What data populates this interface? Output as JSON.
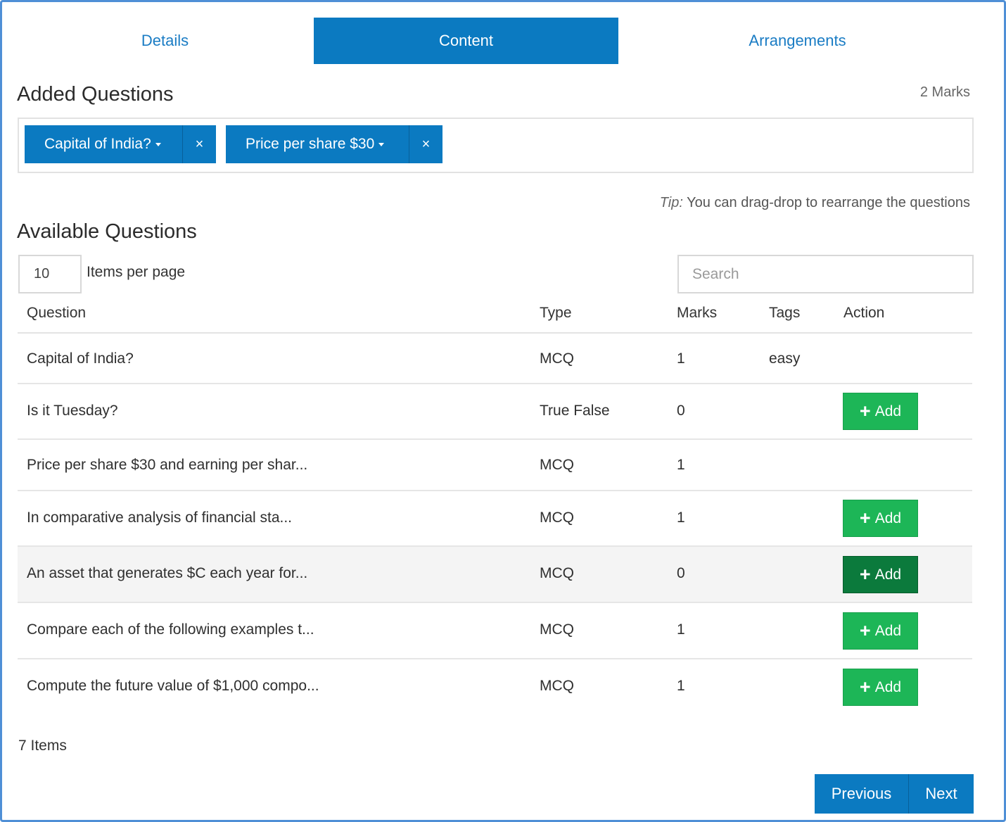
{
  "tabs": [
    {
      "label": "Details",
      "active": false
    },
    {
      "label": "Content",
      "active": true
    },
    {
      "label": "Arrangements",
      "active": false
    }
  ],
  "added": {
    "title": "Added Questions",
    "marks": "2 Marks",
    "chips": [
      {
        "label": "Capital of India?",
        "remove": "×"
      },
      {
        "label": "Price per share $30",
        "remove": "×"
      }
    ],
    "tip_prefix": "Tip:",
    "tip_text": " You can drag-drop to rearrange the questions"
  },
  "available": {
    "title": "Available Questions",
    "per_page_value": "10",
    "per_page_label": "Items per page",
    "search_placeholder": "Search",
    "columns": [
      "Question",
      "Type",
      "Marks",
      "Tags",
      "Action"
    ],
    "rows": [
      {
        "question": "Capital of India?",
        "type": "MCQ",
        "marks": "1",
        "tags": "easy",
        "action": ""
      },
      {
        "question": "Is it Tuesday?",
        "type": "True False",
        "marks": "0",
        "tags": "",
        "action": "Add"
      },
      {
        "question": "Price per share $30 and earning per shar...",
        "type": "MCQ",
        "marks": "1",
        "tags": "",
        "action": ""
      },
      {
        "question": "In comparative analysis of financial sta...",
        "type": "MCQ",
        "marks": "1",
        "tags": "",
        "action": "Add"
      },
      {
        "question": "An asset that generates $C each year for...",
        "type": "MCQ",
        "marks": "0",
        "tags": "",
        "action": "Add"
      },
      {
        "question": "Compare each of the following examples t...",
        "type": "MCQ",
        "marks": "1",
        "tags": "",
        "action": "Add"
      },
      {
        "question": "Compute the future value of $1,000 compo...",
        "type": "MCQ",
        "marks": "1",
        "tags": "",
        "action": "Add"
      }
    ],
    "items_count": "7 Items"
  },
  "pager": {
    "previous": "Previous",
    "next": "Next"
  },
  "colors": {
    "primary": "#0b7ac1",
    "success": "#1db657",
    "success_active": "#0b7a3c"
  },
  "icons": {
    "plus": "plus-icon",
    "remove": "close-icon",
    "caret": "caret-down-icon"
  }
}
